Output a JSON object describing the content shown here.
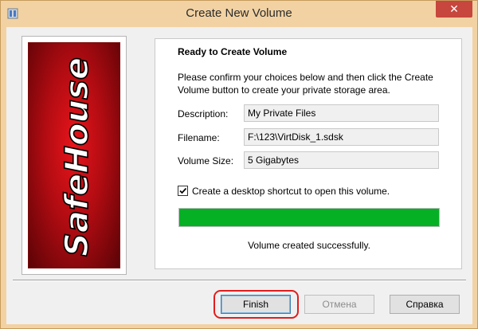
{
  "window": {
    "title": "Create New Volume",
    "close_glyph": "✕",
    "accent_color": "#f2d2a3",
    "app_icon": "safehouse-app-icon"
  },
  "banner": {
    "logo_text": "SafeHouse"
  },
  "panel": {
    "heading": "Ready to Create Volume",
    "intro": "Please confirm your choices below and then click the Create Volume button to create your private storage area.",
    "description_label": "Description:",
    "description_value": "My Private Files",
    "filename_label": "Filename:",
    "filename_value": "F:\\123\\VirtDisk_1.sdsk",
    "size_label": "Volume Size:",
    "size_value": "5 Gigabytes",
    "shortcut_label": "Create a desktop shortcut to open this volume.",
    "shortcut_checked": true,
    "progress_percent": 100,
    "progress_color": "#06b025",
    "status": "Volume created successfully."
  },
  "buttons": {
    "finish": "Finish",
    "cancel": "Отмена",
    "help": "Справка"
  }
}
